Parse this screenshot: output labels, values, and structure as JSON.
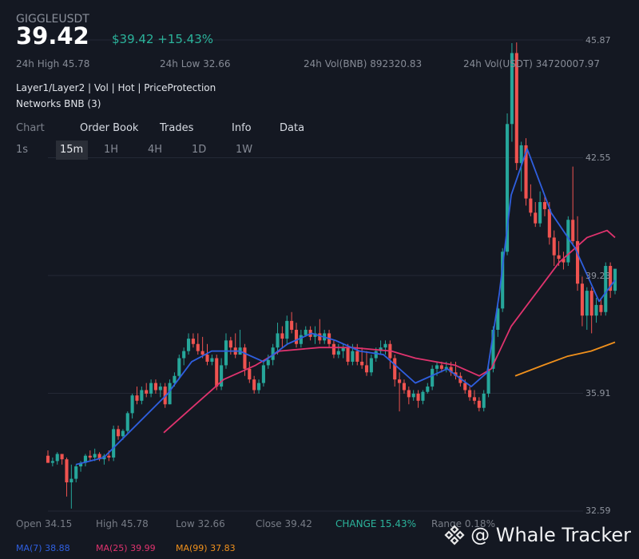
{
  "header": {
    "symbol": "GIGGLEUSDT",
    "price": "39.42",
    "usd_price_change": "$39.42 +15.43%"
  },
  "stats": {
    "high": "24h High 45.78",
    "low": "24h Low 32.66",
    "vol_bnb": "24h Vol(BNB) 892320.83",
    "vol_usdt": "24h Vol(USDT) 34720007.97"
  },
  "tags": "Layer1/Layer2 | Vol | Hot | PriceProtection",
  "networks": "Networks BNB (3)",
  "tabs": [
    "Chart",
    "Order Book",
    "Trades",
    "Info",
    "Data"
  ],
  "intervals": [
    "1s",
    "15m",
    "1H",
    "4H",
    "1D",
    "1W"
  ],
  "active_interval": "15m",
  "footer": {
    "open": "Open 34.15",
    "high": "High 45.78",
    "low": "Low 32.66",
    "close": "Close 39.42",
    "change": "CHANGE 15.43%",
    "range": "Range 0.18%"
  },
  "ma_labels": {
    "ma7": "MA(7) 38.88",
    "ma25": "MA(25) 39.99",
    "ma99": "MA(99) 37.83"
  },
  "brand": "@ Whale Tracker",
  "colors": {
    "up": "#26a69a",
    "down": "#ef5350",
    "ma7": "#2f5fe0",
    "ma25": "#e0336e",
    "ma99": "#f0901c",
    "change": "#2bb39b"
  },
  "chart_data": {
    "type": "candlestick",
    "y_ticks": [
      "45.87",
      "42.55",
      "39.23",
      "35.91",
      "32.59"
    ],
    "ylim": [
      32.59,
      45.87
    ],
    "candles": [
      {
        "o": 34.15,
        "h": 34.3,
        "l": 33.95,
        "c": 33.95
      },
      {
        "o": 33.95,
        "h": 34.1,
        "l": 33.85,
        "c": 34.0
      },
      {
        "o": 34.0,
        "h": 34.25,
        "l": 33.9,
        "c": 34.2
      },
      {
        "o": 34.2,
        "h": 34.2,
        "l": 33.9,
        "c": 34.05
      },
      {
        "o": 34.05,
        "h": 34.1,
        "l": 33.0,
        "c": 33.4
      },
      {
        "o": 33.4,
        "h": 33.9,
        "l": 32.66,
        "c": 33.5
      },
      {
        "o": 33.5,
        "h": 33.9,
        "l": 33.4,
        "c": 33.85
      },
      {
        "o": 33.85,
        "h": 34.0,
        "l": 33.7,
        "c": 33.95
      },
      {
        "o": 33.95,
        "h": 34.2,
        "l": 33.85,
        "c": 34.15
      },
      {
        "o": 34.15,
        "h": 34.3,
        "l": 34.0,
        "c": 34.1
      },
      {
        "o": 34.1,
        "h": 34.35,
        "l": 34.0,
        "c": 34.2
      },
      {
        "o": 34.2,
        "h": 34.25,
        "l": 34.0,
        "c": 34.05
      },
      {
        "o": 34.05,
        "h": 34.2,
        "l": 33.9,
        "c": 34.15
      },
      {
        "o": 34.15,
        "h": 34.3,
        "l": 34.0,
        "c": 34.1
      },
      {
        "o": 34.1,
        "h": 35.0,
        "l": 34.0,
        "c": 34.9
      },
      {
        "o": 34.9,
        "h": 35.0,
        "l": 34.6,
        "c": 34.7
      },
      {
        "o": 34.7,
        "h": 34.9,
        "l": 34.6,
        "c": 34.85
      },
      {
        "o": 34.85,
        "h": 35.4,
        "l": 34.8,
        "c": 35.35
      },
      {
        "o": 35.35,
        "h": 35.9,
        "l": 35.2,
        "c": 35.85
      },
      {
        "o": 35.85,
        "h": 36.1,
        "l": 35.6,
        "c": 35.7
      },
      {
        "o": 35.7,
        "h": 36.1,
        "l": 35.6,
        "c": 36.0
      },
      {
        "o": 36.0,
        "h": 36.2,
        "l": 35.8,
        "c": 35.9
      },
      {
        "o": 35.9,
        "h": 36.3,
        "l": 35.8,
        "c": 36.2
      },
      {
        "o": 36.2,
        "h": 36.3,
        "l": 35.9,
        "c": 36.0
      },
      {
        "o": 36.0,
        "h": 36.2,
        "l": 35.8,
        "c": 36.1
      },
      {
        "o": 36.1,
        "h": 36.2,
        "l": 35.5,
        "c": 35.6
      },
      {
        "o": 35.6,
        "h": 36.3,
        "l": 35.6,
        "c": 36.2
      },
      {
        "o": 36.2,
        "h": 36.5,
        "l": 36.1,
        "c": 36.4
      },
      {
        "o": 36.4,
        "h": 37.0,
        "l": 36.3,
        "c": 36.9
      },
      {
        "o": 36.9,
        "h": 37.2,
        "l": 36.7,
        "c": 37.1
      },
      {
        "o": 37.1,
        "h": 37.6,
        "l": 37.0,
        "c": 37.45
      },
      {
        "o": 37.45,
        "h": 37.6,
        "l": 37.2,
        "c": 37.3
      },
      {
        "o": 37.3,
        "h": 37.6,
        "l": 37.0,
        "c": 37.1
      },
      {
        "o": 37.1,
        "h": 37.5,
        "l": 36.9,
        "c": 37.0
      },
      {
        "o": 37.0,
        "h": 37.3,
        "l": 36.7,
        "c": 36.8
      },
      {
        "o": 36.8,
        "h": 37.0,
        "l": 36.7,
        "c": 36.9
      },
      {
        "o": 36.9,
        "h": 37.0,
        "l": 36.0,
        "c": 36.1
      },
      {
        "o": 36.1,
        "h": 36.9,
        "l": 36.0,
        "c": 36.7
      },
      {
        "o": 36.7,
        "h": 37.6,
        "l": 36.6,
        "c": 37.4
      },
      {
        "o": 37.4,
        "h": 37.5,
        "l": 37.0,
        "c": 37.2
      },
      {
        "o": 37.2,
        "h": 37.6,
        "l": 36.9,
        "c": 37.0
      },
      {
        "o": 37.0,
        "h": 37.7,
        "l": 37.0,
        "c": 37.2
      },
      {
        "o": 37.2,
        "h": 37.3,
        "l": 36.4,
        "c": 36.6
      },
      {
        "o": 36.6,
        "h": 36.8,
        "l": 36.2,
        "c": 36.3
      },
      {
        "o": 36.3,
        "h": 36.4,
        "l": 35.9,
        "c": 36.0
      },
      {
        "o": 36.0,
        "h": 36.3,
        "l": 35.9,
        "c": 36.2
      },
      {
        "o": 36.2,
        "h": 36.8,
        "l": 36.1,
        "c": 36.7
      },
      {
        "o": 36.7,
        "h": 37.0,
        "l": 36.6,
        "c": 36.85
      },
      {
        "o": 36.85,
        "h": 37.3,
        "l": 36.7,
        "c": 37.2
      },
      {
        "o": 37.2,
        "h": 37.9,
        "l": 37.0,
        "c": 37.6
      },
      {
        "o": 37.6,
        "h": 37.8,
        "l": 37.2,
        "c": 37.45
      },
      {
        "o": 37.45,
        "h": 38.1,
        "l": 37.3,
        "c": 37.95
      },
      {
        "o": 37.95,
        "h": 38.2,
        "l": 37.6,
        "c": 37.7
      },
      {
        "o": 37.7,
        "h": 37.9,
        "l": 37.2,
        "c": 37.3
      },
      {
        "o": 37.3,
        "h": 37.7,
        "l": 37.2,
        "c": 37.55
      },
      {
        "o": 37.55,
        "h": 37.8,
        "l": 37.5,
        "c": 37.7
      },
      {
        "o": 37.7,
        "h": 37.8,
        "l": 37.4,
        "c": 37.5
      },
      {
        "o": 37.5,
        "h": 37.8,
        "l": 37.3,
        "c": 37.6
      },
      {
        "o": 37.6,
        "h": 38.0,
        "l": 37.3,
        "c": 37.4
      },
      {
        "o": 37.4,
        "h": 37.7,
        "l": 37.3,
        "c": 37.6
      },
      {
        "o": 37.6,
        "h": 37.7,
        "l": 37.2,
        "c": 37.3
      },
      {
        "o": 37.3,
        "h": 37.4,
        "l": 36.9,
        "c": 37.0
      },
      {
        "o": 37.0,
        "h": 37.3,
        "l": 36.9,
        "c": 37.1
      },
      {
        "o": 37.1,
        "h": 37.3,
        "l": 36.9,
        "c": 37.2
      },
      {
        "o": 37.2,
        "h": 37.3,
        "l": 36.7,
        "c": 36.8
      },
      {
        "o": 36.8,
        "h": 37.3,
        "l": 36.7,
        "c": 37.1
      },
      {
        "o": 37.1,
        "h": 37.3,
        "l": 36.7,
        "c": 36.8
      },
      {
        "o": 36.8,
        "h": 37.2,
        "l": 36.6,
        "c": 36.7
      },
      {
        "o": 36.7,
        "h": 37.1,
        "l": 36.4,
        "c": 36.5
      },
      {
        "o": 36.5,
        "h": 37.0,
        "l": 36.4,
        "c": 36.9
      },
      {
        "o": 36.9,
        "h": 37.2,
        "l": 36.8,
        "c": 37.1
      },
      {
        "o": 37.1,
        "h": 37.4,
        "l": 37.0,
        "c": 37.2
      },
      {
        "o": 37.2,
        "h": 37.4,
        "l": 37.0,
        "c": 37.3
      },
      {
        "o": 37.3,
        "h": 37.4,
        "l": 36.6,
        "c": 36.9
      },
      {
        "o": 36.9,
        "h": 37.0,
        "l": 36.1,
        "c": 36.3
      },
      {
        "o": 36.3,
        "h": 36.5,
        "l": 35.4,
        "c": 36.2
      },
      {
        "o": 36.2,
        "h": 36.3,
        "l": 35.9,
        "c": 36.0
      },
      {
        "o": 36.0,
        "h": 36.1,
        "l": 35.6,
        "c": 35.8
      },
      {
        "o": 35.8,
        "h": 36.0,
        "l": 35.7,
        "c": 35.9
      },
      {
        "o": 35.9,
        "h": 36.0,
        "l": 35.5,
        "c": 35.7
      },
      {
        "o": 35.7,
        "h": 36.0,
        "l": 35.6,
        "c": 35.95
      },
      {
        "o": 35.95,
        "h": 36.2,
        "l": 35.9,
        "c": 36.1
      },
      {
        "o": 36.1,
        "h": 36.7,
        "l": 36.0,
        "c": 36.6
      },
      {
        "o": 36.6,
        "h": 36.8,
        "l": 36.4,
        "c": 36.7
      },
      {
        "o": 36.7,
        "h": 36.8,
        "l": 36.5,
        "c": 36.6
      },
      {
        "o": 36.6,
        "h": 36.8,
        "l": 36.5,
        "c": 36.65
      },
      {
        "o": 36.65,
        "h": 36.8,
        "l": 36.4,
        "c": 36.5
      },
      {
        "o": 36.5,
        "h": 36.8,
        "l": 36.3,
        "c": 36.4
      },
      {
        "o": 36.4,
        "h": 36.5,
        "l": 36.1,
        "c": 36.2
      },
      {
        "o": 36.2,
        "h": 36.3,
        "l": 35.9,
        "c": 36.0
      },
      {
        "o": 36.0,
        "h": 36.1,
        "l": 35.7,
        "c": 35.8
      },
      {
        "o": 35.8,
        "h": 36.0,
        "l": 35.6,
        "c": 35.7
      },
      {
        "o": 35.7,
        "h": 35.8,
        "l": 35.4,
        "c": 35.5
      },
      {
        "o": 35.5,
        "h": 36.0,
        "l": 35.4,
        "c": 35.9
      },
      {
        "o": 35.9,
        "h": 36.7,
        "l": 35.8,
        "c": 36.6
      },
      {
        "o": 36.6,
        "h": 37.8,
        "l": 36.5,
        "c": 37.7
      },
      {
        "o": 37.7,
        "h": 38.4,
        "l": 37.5,
        "c": 38.3
      },
      {
        "o": 38.3,
        "h": 40.0,
        "l": 38.2,
        "c": 39.9
      },
      {
        "o": 39.9,
        "h": 43.8,
        "l": 39.8,
        "c": 43.5
      },
      {
        "o": 43.5,
        "h": 45.78,
        "l": 43.0,
        "c": 45.5
      },
      {
        "o": 45.5,
        "h": 45.8,
        "l": 42.2,
        "c": 42.4
      },
      {
        "o": 42.4,
        "h": 43.0,
        "l": 41.6,
        "c": 42.9
      },
      {
        "o": 42.9,
        "h": 43.1,
        "l": 41.2,
        "c": 41.4
      },
      {
        "o": 41.4,
        "h": 41.8,
        "l": 40.9,
        "c": 41.0
      },
      {
        "o": 41.0,
        "h": 41.3,
        "l": 40.6,
        "c": 40.7
      },
      {
        "o": 40.7,
        "h": 41.6,
        "l": 40.6,
        "c": 41.3
      },
      {
        "o": 41.3,
        "h": 41.5,
        "l": 40.9,
        "c": 41.1
      },
      {
        "o": 41.1,
        "h": 41.3,
        "l": 40.1,
        "c": 40.3
      },
      {
        "o": 40.3,
        "h": 40.5,
        "l": 39.5,
        "c": 39.8
      },
      {
        "o": 39.8,
        "h": 40.2,
        "l": 39.5,
        "c": 39.7
      },
      {
        "o": 39.7,
        "h": 39.9,
        "l": 39.4,
        "c": 39.6
      },
      {
        "o": 39.6,
        "h": 40.9,
        "l": 39.5,
        "c": 40.8
      },
      {
        "o": 40.8,
        "h": 42.3,
        "l": 40.1,
        "c": 40.2
      },
      {
        "o": 40.2,
        "h": 40.9,
        "l": 38.8,
        "c": 39.0
      },
      {
        "o": 39.0,
        "h": 39.2,
        "l": 37.8,
        "c": 38.1
      },
      {
        "o": 38.1,
        "h": 38.9,
        "l": 37.7,
        "c": 38.8
      },
      {
        "o": 38.8,
        "h": 38.9,
        "l": 37.6,
        "c": 38.1
      },
      {
        "o": 38.1,
        "h": 38.6,
        "l": 37.9,
        "c": 38.4
      },
      {
        "o": 38.4,
        "h": 38.6,
        "l": 38.1,
        "c": 38.2
      },
      {
        "o": 38.2,
        "h": 39.6,
        "l": 38.1,
        "c": 39.5
      },
      {
        "o": 39.5,
        "h": 39.6,
        "l": 38.6,
        "c": 38.8
      },
      {
        "o": 38.8,
        "h": 39.4,
        "l": 38.7,
        "c": 39.42
      }
    ],
    "x_step_px_hint": null,
    "ma7_points": [
      [
        95,
        33.9
      ],
      [
        130,
        34.1
      ],
      [
        170,
        35.0
      ],
      [
        210,
        35.9
      ],
      [
        240,
        36.8
      ],
      [
        265,
        37.1
      ],
      [
        300,
        37.1
      ],
      [
        330,
        36.8
      ],
      [
        360,
        37.3
      ],
      [
        390,
        37.6
      ],
      [
        420,
        37.4
      ],
      [
        450,
        37.1
      ],
      [
        480,
        37.0
      ],
      [
        520,
        36.2
      ],
      [
        560,
        36.6
      ],
      [
        590,
        36.1
      ],
      [
        610,
        36.5
      ],
      [
        625,
        38.7
      ],
      [
        640,
        41.5
      ],
      [
        660,
        42.8
      ],
      [
        690,
        41.0
      ],
      [
        720,
        40.0
      ],
      [
        750,
        38.5
      ],
      [
        770,
        39.1
      ]
    ],
    "ma25_points": [
      [
        205,
        34.8
      ],
      [
        240,
        35.5
      ],
      [
        280,
        36.3
      ],
      [
        320,
        36.7
      ],
      [
        350,
        37.1
      ],
      [
        400,
        37.2
      ],
      [
        440,
        37.2
      ],
      [
        490,
        37.1
      ],
      [
        520,
        36.9
      ],
      [
        570,
        36.7
      ],
      [
        600,
        36.4
      ],
      [
        615,
        36.6
      ],
      [
        640,
        37.8
      ],
      [
        670,
        38.7
      ],
      [
        700,
        39.6
      ],
      [
        735,
        40.3
      ],
      [
        760,
        40.5
      ],
      [
        770,
        40.3
      ]
    ],
    "ma99_points": [
      [
        645,
        36.4
      ],
      [
        680,
        36.7
      ],
      [
        710,
        36.95
      ],
      [
        740,
        37.1
      ],
      [
        770,
        37.35
      ]
    ]
  }
}
